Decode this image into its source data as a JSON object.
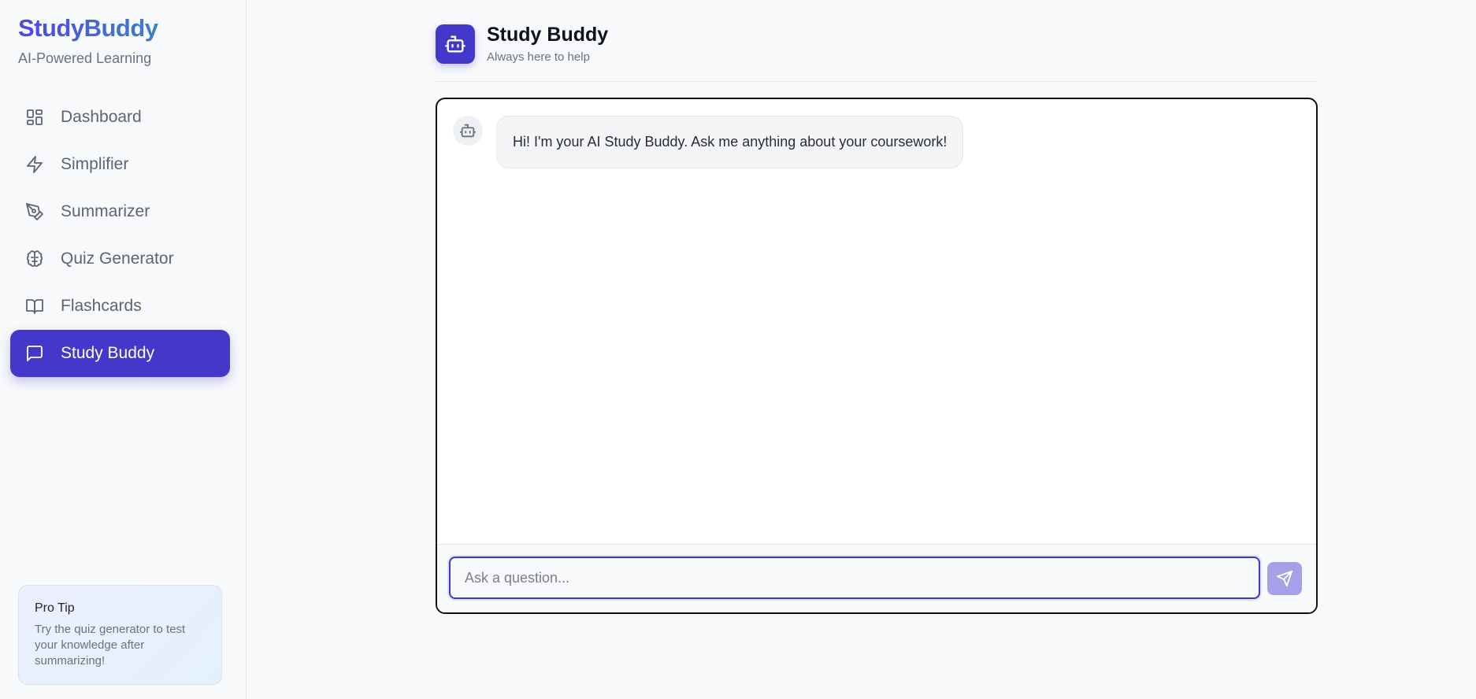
{
  "sidebar": {
    "brand": "StudyBuddy",
    "tagline": "AI-Powered Learning",
    "items": [
      {
        "label": "Dashboard",
        "icon": "dashboard-icon",
        "active": false
      },
      {
        "label": "Simplifier",
        "icon": "lightning-icon",
        "active": false
      },
      {
        "label": "Summarizer",
        "icon": "pen-tool-icon",
        "active": false
      },
      {
        "label": "Quiz Generator",
        "icon": "brain-icon",
        "active": false
      },
      {
        "label": "Flashcards",
        "icon": "book-open-icon",
        "active": false
      },
      {
        "label": "Study Buddy",
        "icon": "message-square-icon",
        "active": true
      }
    ],
    "tip": {
      "title": "Pro Tip",
      "body": "Try the quiz generator to test your knowledge after summarizing!"
    }
  },
  "header": {
    "title": "Study Buddy",
    "subtitle": "Always here to help",
    "icon": "bot-icon"
  },
  "chat": {
    "messages": [
      {
        "role": "bot",
        "avatar_icon": "bot-icon",
        "text": "Hi! I'm your AI Study Buddy. Ask me anything about your coursework!"
      }
    ],
    "input": {
      "value": "",
      "placeholder": "Ask a question..."
    },
    "send_icon": "send-icon"
  },
  "colors": {
    "accent": "#4338ca",
    "send_button": "#a5a1e6",
    "background": "#f8f9fb"
  }
}
